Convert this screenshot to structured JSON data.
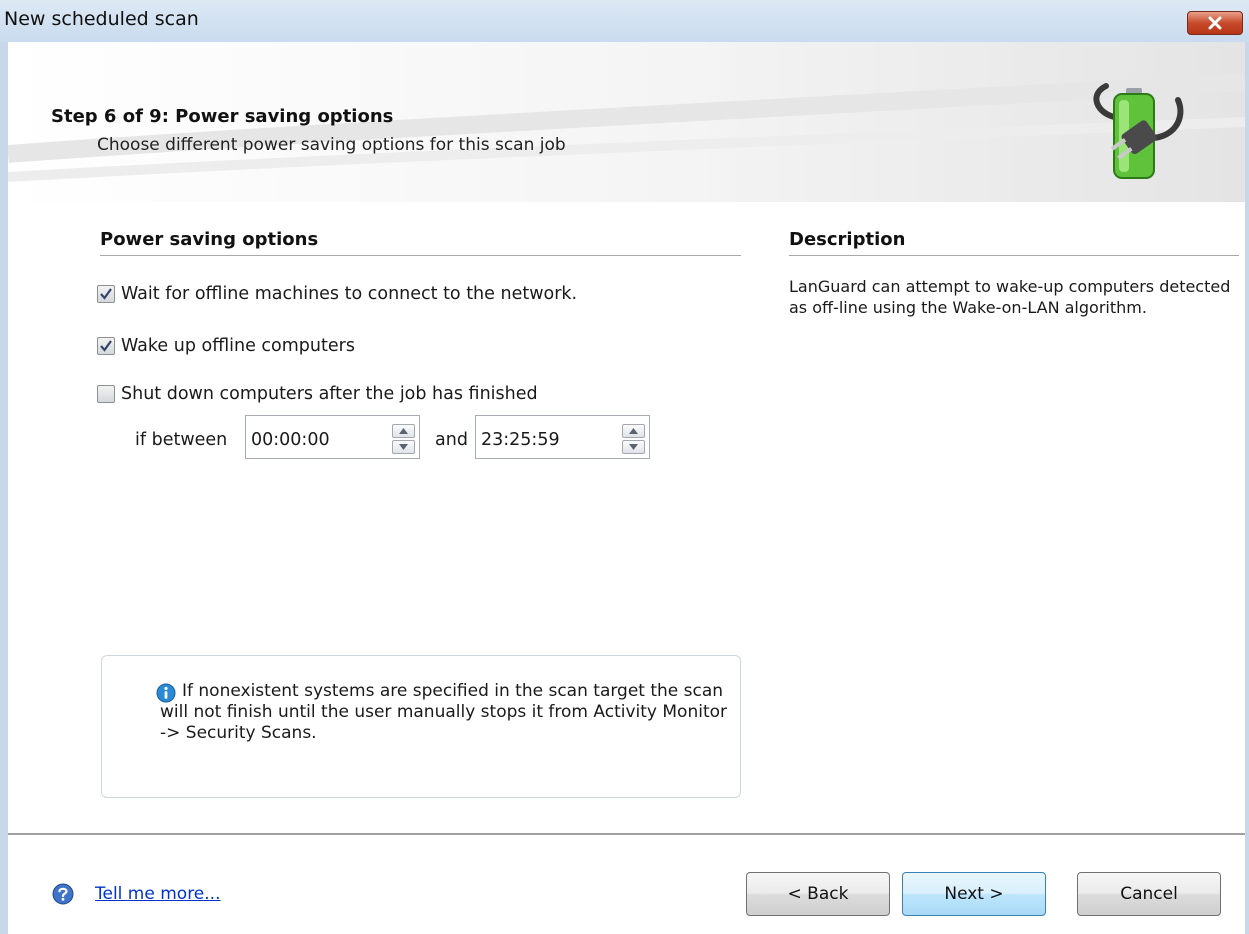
{
  "window": {
    "title": "New scheduled scan"
  },
  "header": {
    "step_title": "Step 6 of 9: Power saving options",
    "step_subtitle": "Choose different power saving options for this scan job"
  },
  "options": {
    "heading": "Power saving options",
    "items": [
      {
        "label": "Wait for offline machines to connect to the network.",
        "checked": true
      },
      {
        "label": "Wake up offline computers",
        "checked": true
      },
      {
        "label": "Shut down computers after the job has finished",
        "checked": false
      }
    ],
    "range": {
      "if_between_label": "if between",
      "start_time": "00:00:00",
      "and_label": "and",
      "end_time": "23:25:59"
    }
  },
  "description": {
    "heading": "Description",
    "text": "LanGuard can attempt to wake-up computers detected as off-line using the Wake-on-LAN algorithm."
  },
  "info_box": {
    "text": "If nonexistent systems are specified in the scan target the scan will not finish until the user manually stops it from Activity Monitor -> Security Scans."
  },
  "footer": {
    "help_link": "Tell me more...",
    "back_label": "< Back",
    "next_label": "Next >",
    "cancel_label": "Cancel"
  },
  "icons": [
    "close-icon",
    "battery-plug-icon",
    "info-icon",
    "help-icon",
    "checkmark-icon",
    "spin-up-arrow-icon",
    "spin-down-arrow-icon"
  ],
  "colors": {
    "link": "#0033cc",
    "title_bar": "#c9dbee",
    "close_button": "#c84a2c",
    "primary_button": "#bee6fd"
  }
}
